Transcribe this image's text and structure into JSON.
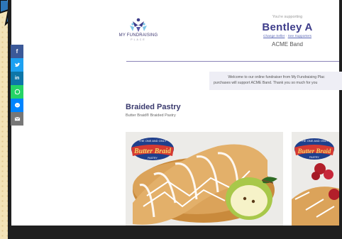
{
  "colors": {
    "facebook": "#3b5998",
    "twitter": "#1da1f2",
    "linkedin": "#0e76a8",
    "whatsapp": "#25d366",
    "messenger": "#0084ff",
    "email": "#777777",
    "brand": "#3d3c8a"
  },
  "share": {
    "icons": [
      "facebook-icon",
      "twitter-icon",
      "linkedin-icon",
      "whatsapp-icon",
      "messenger-icon",
      "email-icon"
    ],
    "facebook_glyph": "f",
    "linkedin_glyph": "in"
  },
  "logo": {
    "name": "MY FUNDRAISING",
    "place": "PLACE"
  },
  "supporting": {
    "label": "You're supporting",
    "name": "Bentley A",
    "change_seller": "Change Seller",
    "separator": " · ",
    "see_supporters": "See Supporters",
    "group": "ACME Band"
  },
  "welcome": {
    "line1": "Welcome to our online fundraiser from My Fundraising Plac",
    "line2": "purchases will support ACME Band. Thank you so much for you"
  },
  "product_section": {
    "title": "Braided Pastry",
    "subtitle": "Butter Braid® Braided Pastry"
  },
  "cards": [
    {
      "badge_small": "THE ONE AND ONLY",
      "badge_main": "Butter Braid",
      "badge_bottom": "PASTRY"
    },
    {
      "badge_small": "THE ONE AND ONLY",
      "badge_main": "Butter Braid",
      "badge_bottom": "PASTRY"
    }
  ]
}
